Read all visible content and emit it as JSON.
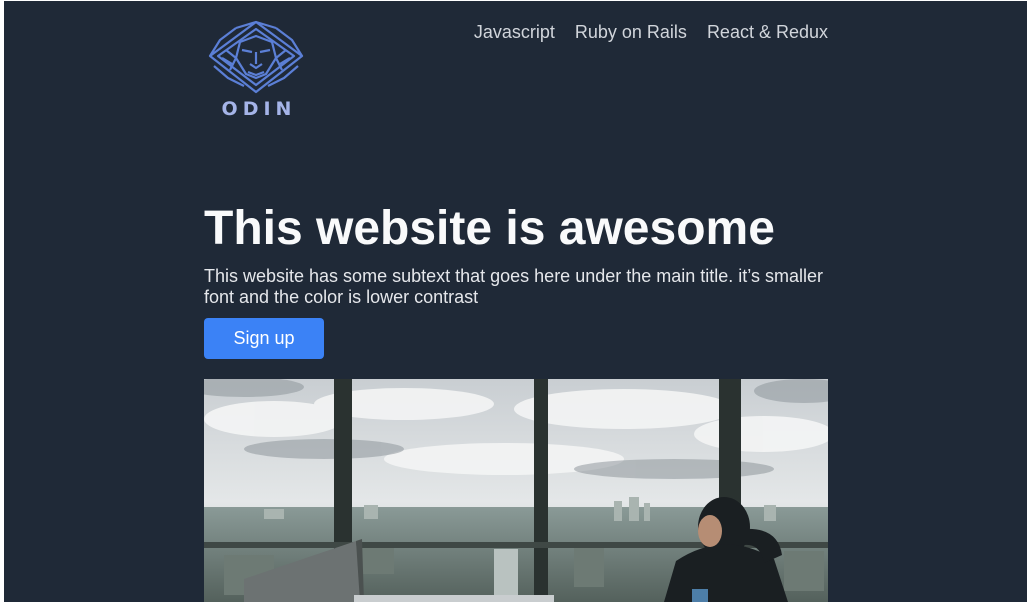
{
  "brand": {
    "logo_icon": "lion-head-icon",
    "name": "ODIN",
    "accent": "#5b7fd6"
  },
  "nav": {
    "items": [
      {
        "label": "Javascript"
      },
      {
        "label": "Ruby on Rails"
      },
      {
        "label": "React & Redux"
      }
    ]
  },
  "hero": {
    "title": "This website is awesome",
    "subtitle": "This website has some subtext that goes here under the main title. it’s smaller font and the color is lower contrast",
    "cta_label": "Sign up",
    "cta_color": "#3b82f6",
    "image_icon": "office-window-photo"
  },
  "colors": {
    "background": "#1f2937",
    "title": "#f9fafb",
    "nav_text": "#d1d5db"
  }
}
